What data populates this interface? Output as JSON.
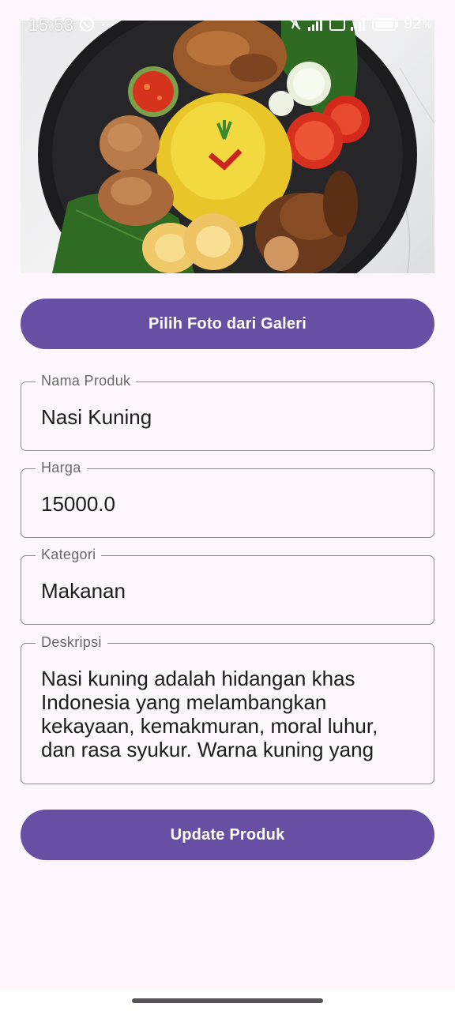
{
  "status_bar": {
    "time": "15:53",
    "more": "···",
    "battery": "92",
    "battery_unit": "%"
  },
  "photo": {
    "subject-icon": "nasi-kuning-plate"
  },
  "gallery_button": {
    "label": "Pilih Foto dari Galeri"
  },
  "form": {
    "nama": {
      "label": "Nama Produk",
      "value": "Nasi Kuning"
    },
    "harga": {
      "label": "Harga",
      "value": "15000.0"
    },
    "kategori": {
      "label": "Kategori",
      "value": "Makanan"
    },
    "deskripsi": {
      "label": "Deskripsi",
      "value": "Nasi kuning adalah hidangan khas Indonesia yang melambangkan kekayaan, kemakmuran, moral luhur, dan rasa syukur. Warna kuning yang berasal"
    }
  },
  "update_button": {
    "label": "Update Produk"
  },
  "colors": {
    "primary": "#6750a4",
    "background": "#fdf7fd",
    "outline": "#8e8a93"
  }
}
